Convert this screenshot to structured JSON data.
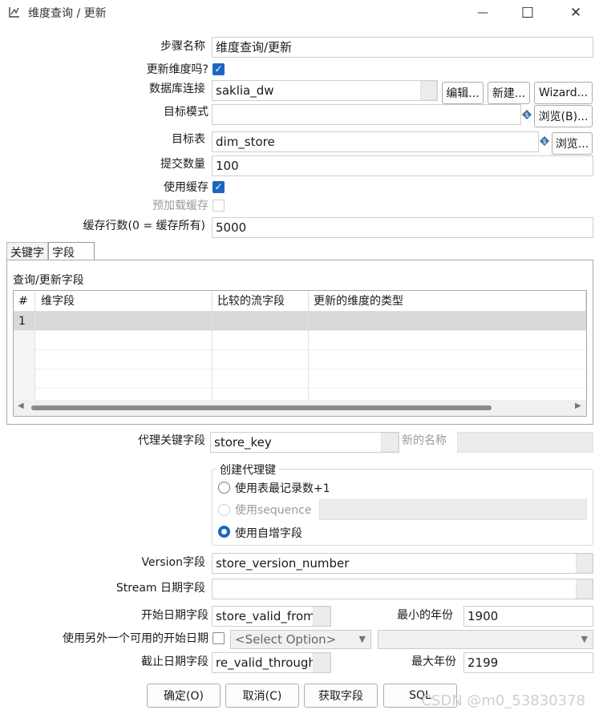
{
  "window": {
    "title": "维度查询 / 更新",
    "minimize": "—",
    "maximize": "☐",
    "close": "✕"
  },
  "form": {
    "step_name_label": "步骤名称",
    "step_name": "维度查询/更新",
    "update_dim_label": "更新维度吗?",
    "update_dim_checked": true,
    "db_conn_label": "数据库连接",
    "db_conn": "saklia_dw",
    "edit_btn": "编辑...",
    "new_btn": "新建...",
    "wizard_btn": "Wizard...",
    "target_schema_label": "目标模式",
    "target_schema": "",
    "browse_b_btn": "浏览(B)...",
    "target_table_label": "目标表",
    "target_table": "dim_store",
    "browse_btn": "浏览...",
    "commit_label": "提交数量",
    "commit_size": "100",
    "use_cache_label": "使用缓存",
    "use_cache_checked": true,
    "preload_label": "预加载缓存",
    "preload_checked": false,
    "cache_rows_label": "缓存行数(0 = 缓存所有)",
    "cache_rows": "5000"
  },
  "tabs": [
    "关键字",
    "字段"
  ],
  "fields_section": {
    "title": "查询/更新字段",
    "columns": [
      "#",
      "维字段",
      "比较的流字段",
      "更新的维度的类型"
    ],
    "rows": [
      {
        "num": "1",
        "dim": "",
        "stream": "",
        "type": ""
      }
    ]
  },
  "surrogate": {
    "key_label": "代理关键字段",
    "key_value": "store_key",
    "new_name_label": "新的名称",
    "new_name": "",
    "group_title": "创建代理键",
    "opt_table_max": "使用表最记录数+1",
    "opt_sequence": "使用sequence",
    "opt_autoinc": "使用自增字段",
    "selected": "autoinc"
  },
  "version": {
    "label": "Version字段",
    "value": "store_version_number"
  },
  "stream_date": {
    "label": "Stream 日期字段",
    "value": ""
  },
  "start_date": {
    "label": "开始日期字段",
    "value": "store_valid_from",
    "min_year_label": "最小的年份",
    "min_year": "1900"
  },
  "alt_start": {
    "label": "使用另外一个可用的开始日期",
    "checked": false,
    "select_placeholder": "<Select Option>",
    "select2": ""
  },
  "end_date": {
    "label": "截止日期字段",
    "value": "re_valid_through",
    "max_year_label": "最大年份",
    "max_year": "2199"
  },
  "buttons": {
    "ok": "确定(O)",
    "cancel": "取消(C)",
    "get_fields": "获取字段",
    "sql": "SQL"
  },
  "watermark": "CSDN @m0_53830378",
  "colors": {
    "accent": "#1c66c2",
    "readonly_bg": "#ececec"
  }
}
